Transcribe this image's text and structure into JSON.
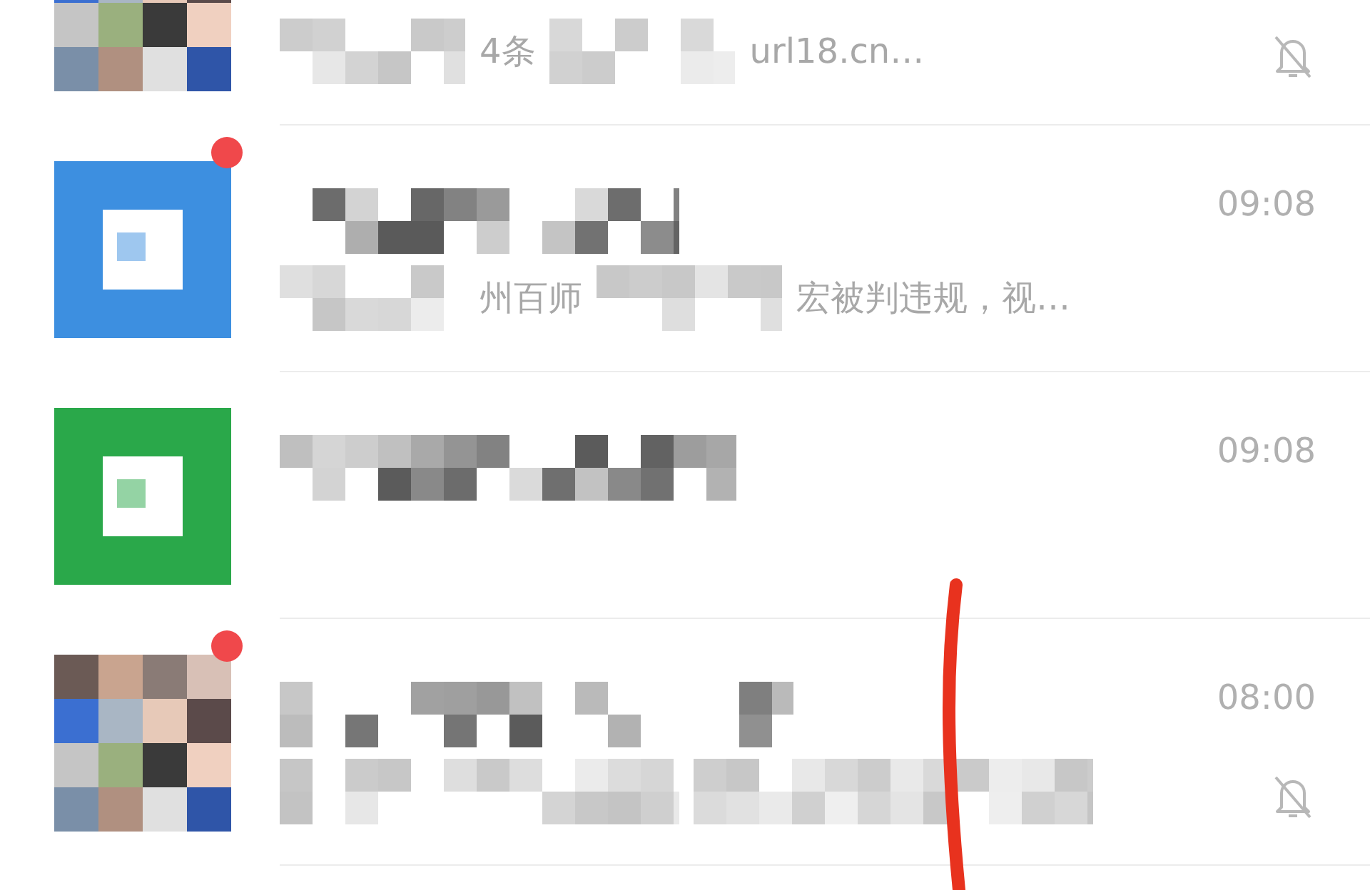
{
  "chats": [
    {
      "kind": "partial",
      "avatar": {
        "kind": "grid"
      },
      "unread": false,
      "muted": true,
      "preview": [
        {
          "kind": "mosaic"
        },
        {
          "kind": "text",
          "text": "4条"
        },
        {
          "kind": "mosaic"
        },
        {
          "kind": "text",
          "text": "url18.cn…"
        }
      ]
    },
    {
      "kind": "full",
      "avatar": {
        "kind": "blue-app"
      },
      "unread": true,
      "muted": false,
      "time": "09:08",
      "preview": [
        {
          "kind": "mosaic"
        },
        {
          "kind": "text",
          "text": "州百师"
        },
        {
          "kind": "mosaic"
        },
        {
          "kind": "text",
          "text": "宏被判违规，视…"
        }
      ]
    },
    {
      "kind": "full",
      "avatar": {
        "kind": "green-app"
      },
      "unread": false,
      "muted": false,
      "time": "09:08"
    },
    {
      "kind": "full",
      "avatar": {
        "kind": "grid"
      },
      "unread": true,
      "muted": true,
      "time": "08:00",
      "preview": [
        {
          "kind": "mosaic"
        },
        {
          "kind": "mosaic"
        }
      ]
    }
  ]
}
